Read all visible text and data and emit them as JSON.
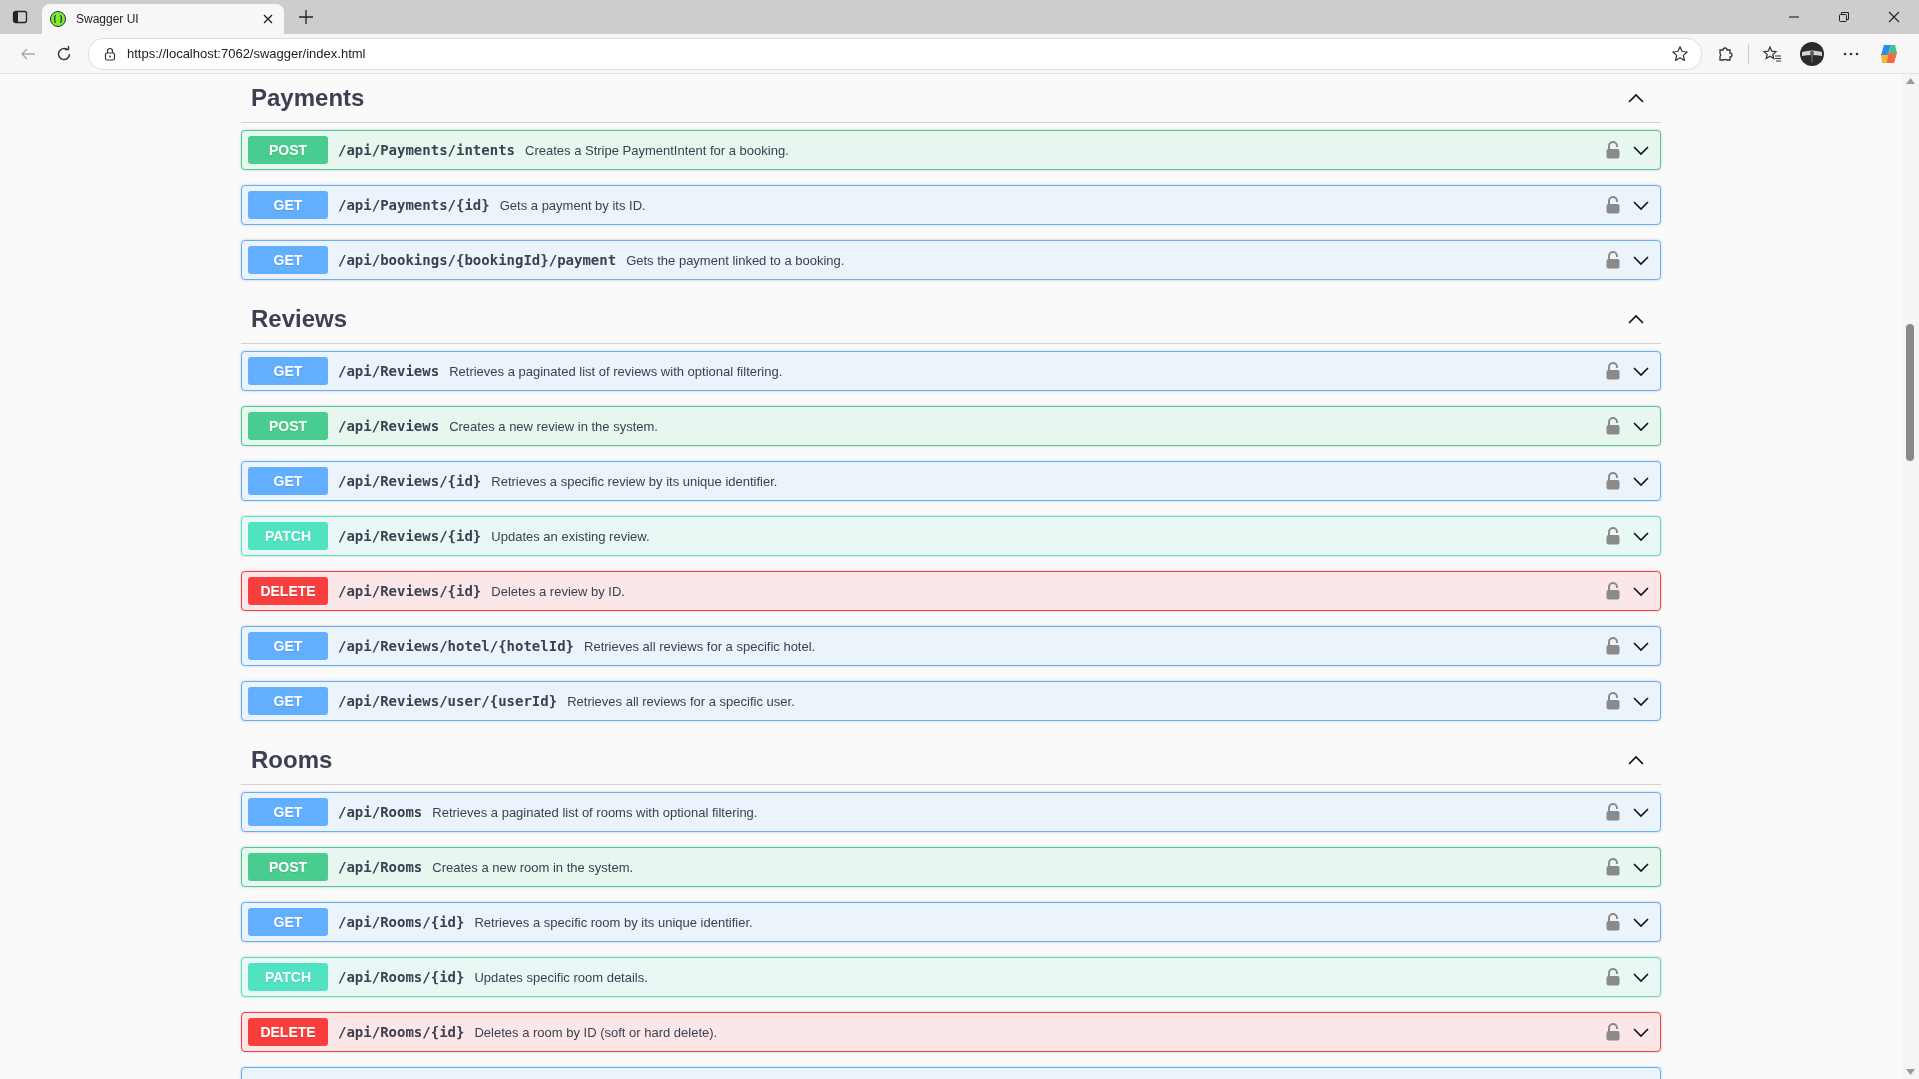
{
  "browser": {
    "tab_title": "Swagger UI",
    "url": "https://localhost:7062/swagger/index.html"
  },
  "sections": [
    {
      "name": "Payments",
      "expanded": true,
      "endpoints": [
        {
          "kind": "full",
          "method": "POST",
          "path": "/api/Payments/intents",
          "summary": "Creates a Stripe PaymentIntent for a booking.",
          "expanded": false
        },
        {
          "kind": "full",
          "method": "GET",
          "path": "/api/Payments/{id}",
          "summary": "Gets a payment by its ID.",
          "expanded": false
        },
        {
          "kind": "full",
          "method": "GET",
          "path": "/api/bookings/{bookingId}/payment",
          "summary": "Gets the payment linked to a booking.",
          "expanded": false
        }
      ]
    },
    {
      "name": "Reviews",
      "expanded": true,
      "endpoints": [
        {
          "kind": "full",
          "method": "GET",
          "path": "/api/Reviews",
          "summary": "Retrieves a paginated list of reviews with optional filtering.",
          "expanded": false
        },
        {
          "kind": "full",
          "method": "POST",
          "path": "/api/Reviews",
          "summary": "Creates a new review in the system.",
          "expanded": false
        },
        {
          "kind": "full",
          "method": "GET",
          "path": "/api/Reviews/{id}",
          "summary": "Retrieves a specific review by its unique identifier.",
          "expanded": false
        },
        {
          "kind": "full",
          "method": "PATCH",
          "path": "/api/Reviews/{id}",
          "summary": "Updates an existing review.",
          "expanded": false
        },
        {
          "kind": "full",
          "method": "DELETE",
          "path": "/api/Reviews/{id}",
          "summary": "Deletes a review by ID.",
          "expanded": false
        },
        {
          "kind": "full",
          "method": "GET",
          "path": "/api/Reviews/hotel/{hotelId}",
          "summary": "Retrieves all reviews for a specific hotel.",
          "expanded": false
        },
        {
          "kind": "full",
          "method": "GET",
          "path": "/api/Reviews/user/{userId}",
          "summary": "Retrieves all reviews for a specific user.",
          "expanded": false
        }
      ]
    },
    {
      "name": "Rooms",
      "expanded": true,
      "endpoints": [
        {
          "kind": "full",
          "method": "GET",
          "path": "/api/Rooms",
          "summary": "Retrieves a paginated list of rooms with optional filtering.",
          "expanded": false
        },
        {
          "kind": "full",
          "method": "POST",
          "path": "/api/Rooms",
          "summary": "Creates a new room in the system.",
          "expanded": false
        },
        {
          "kind": "full",
          "method": "GET",
          "path": "/api/Rooms/{id}",
          "summary": "Retrieves a specific room by its unique identifier.",
          "expanded": false
        },
        {
          "kind": "full",
          "method": "PATCH",
          "path": "/api/Rooms/{id}",
          "summary": "Updates specific room details.",
          "expanded": false
        },
        {
          "kind": "full",
          "method": "DELETE",
          "path": "/api/Rooms/{id}",
          "summary": "Deletes a room by ID (soft or hard delete).",
          "expanded": false
        },
        {
          "kind": "partial"
        }
      ]
    }
  ]
}
